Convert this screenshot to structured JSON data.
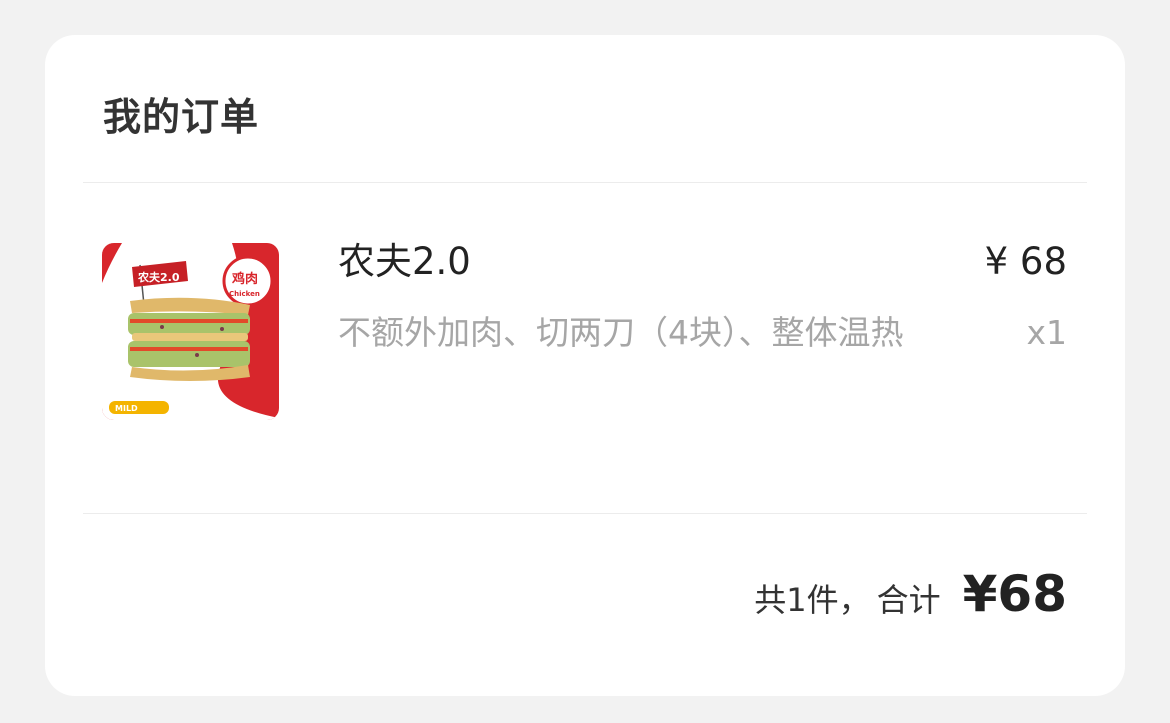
{
  "card": {
    "title": "我的订单"
  },
  "order_item": {
    "image_icon": "sandwich-product-image",
    "image_badges": {
      "flag": "农夫2.0",
      "meat_label_cn": "鸡肉",
      "meat_label_en": "Chicken",
      "spice_label": "MILD"
    },
    "name": "农夫2.0",
    "price": "¥ 68",
    "options": "不额外加肉、切两刀（4块）、整体温热",
    "quantity": "x1"
  },
  "summary": {
    "count_text": "共1件，",
    "total_label": "合计",
    "total_value": "¥68"
  },
  "colors": {
    "background": "#f2f2f2",
    "card": "#ffffff",
    "brand_red": "#d8262c",
    "primary_text": "#222222",
    "secondary_text": "#a6a6a6"
  }
}
